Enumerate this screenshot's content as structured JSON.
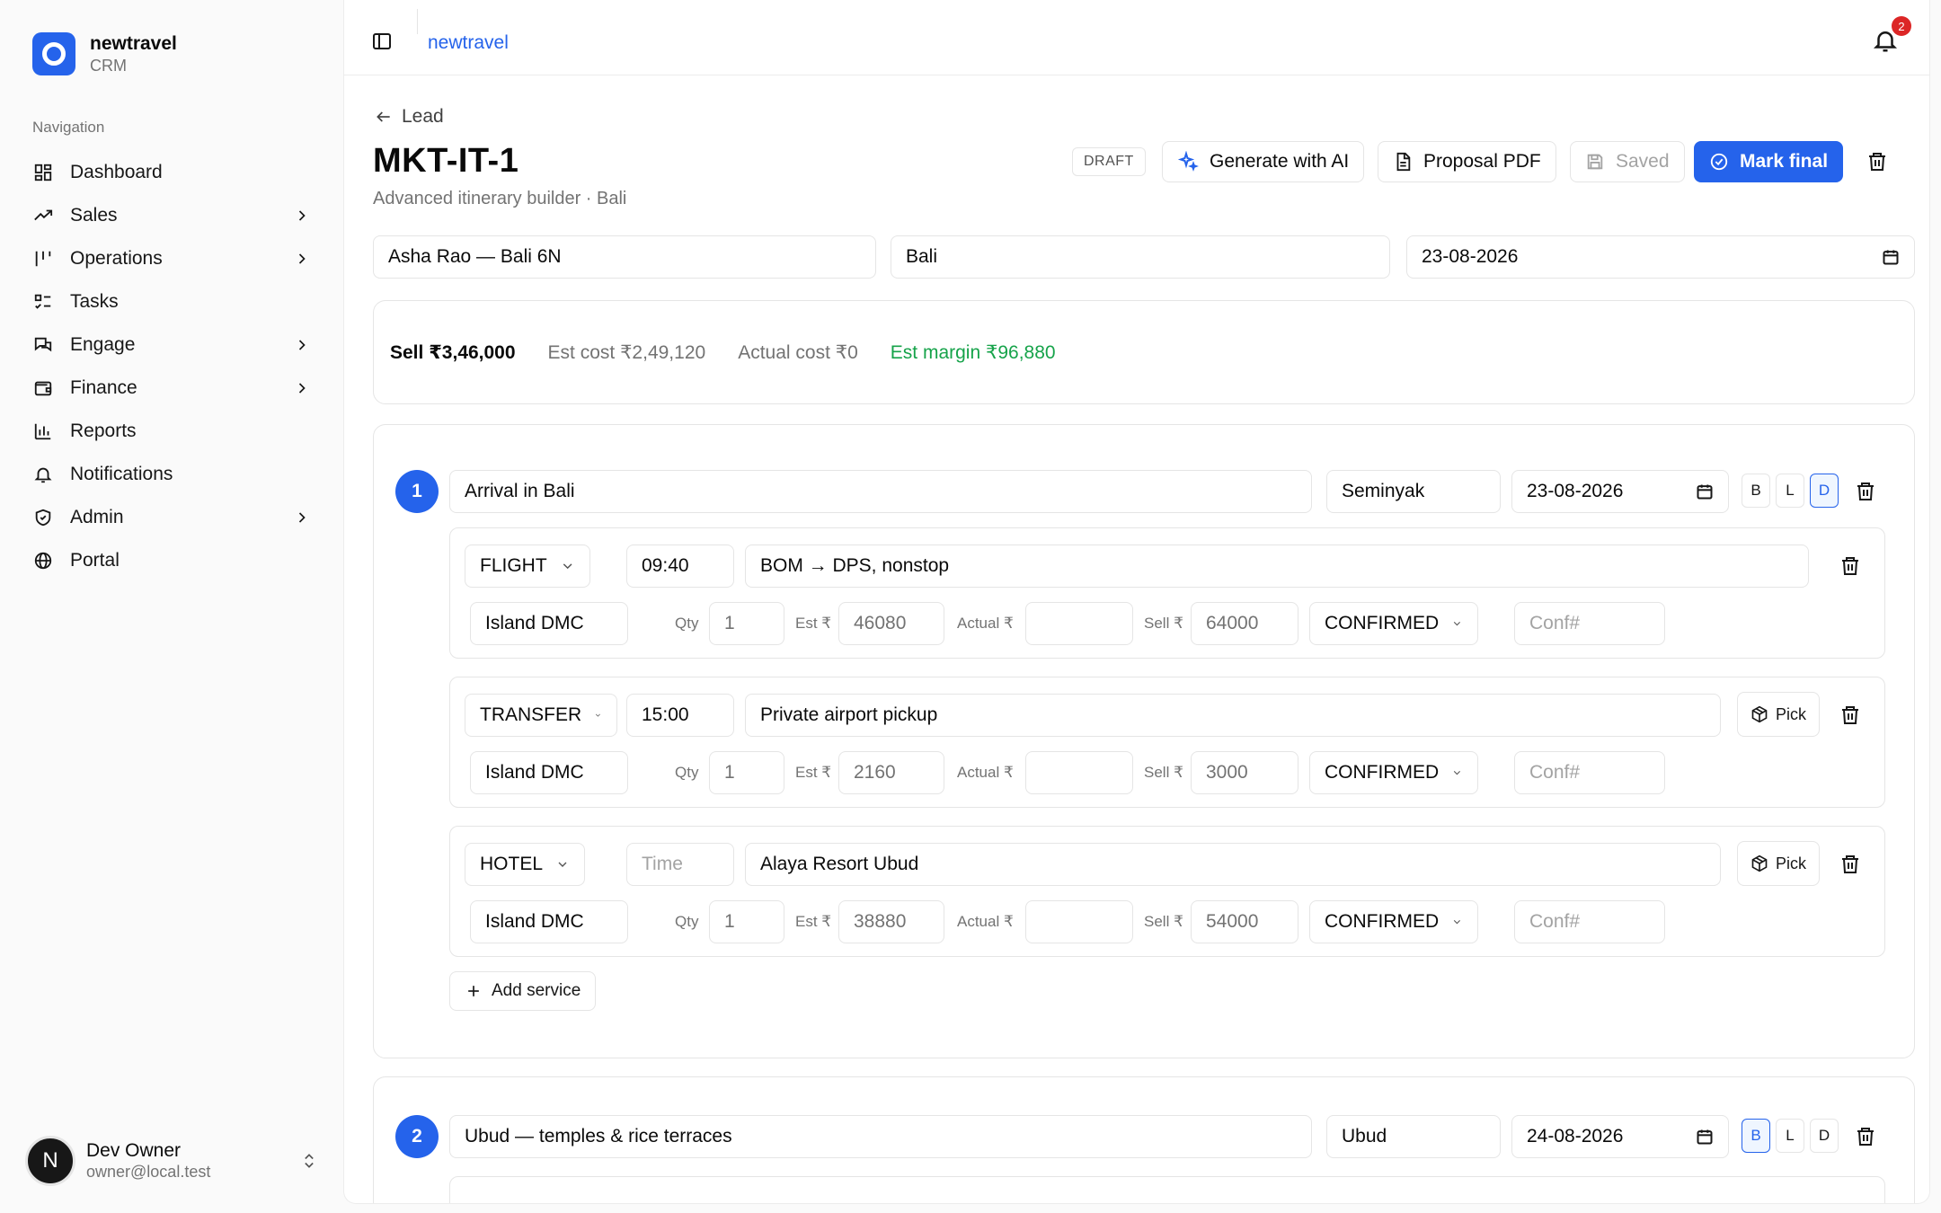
{
  "brand": {
    "name": "newtravel",
    "sub": "CRM"
  },
  "nav": {
    "title": "Navigation",
    "items": [
      {
        "label": "Dashboard",
        "icon": "dashboard-icon",
        "chevron": false
      },
      {
        "label": "Sales",
        "icon": "trending-icon",
        "chevron": true
      },
      {
        "label": "Operations",
        "icon": "operations-icon",
        "chevron": true
      },
      {
        "label": "Tasks",
        "icon": "tasks-icon",
        "chevron": false
      },
      {
        "label": "Engage",
        "icon": "messages-icon",
        "chevron": true
      },
      {
        "label": "Finance",
        "icon": "wallet-icon",
        "chevron": true
      },
      {
        "label": "Reports",
        "icon": "bar-chart-icon",
        "chevron": false
      },
      {
        "label": "Notifications",
        "icon": "bell-icon",
        "chevron": false
      },
      {
        "label": "Admin",
        "icon": "shield-icon",
        "chevron": true
      },
      {
        "label": "Portal",
        "icon": "globe-icon",
        "chevron": false
      }
    ]
  },
  "user": {
    "initial": "N",
    "name": "Dev Owner",
    "email": "owner@local.test"
  },
  "topbar": {
    "breadcrumb": "newtravel",
    "notification_count": "2"
  },
  "page": {
    "back_label": "Lead",
    "title": "MKT-IT-1",
    "subtitle": "Advanced itinerary builder · Bali",
    "status": "DRAFT",
    "actions": {
      "generate": "Generate with AI",
      "pdf": "Proposal PDF",
      "saved": "Saved",
      "final": "Mark final"
    },
    "fields": {
      "name": "Asha Rao — Bali 6N",
      "destination": "Bali",
      "start_date": "23-08-2026"
    }
  },
  "summary": {
    "sell": "Sell ₹3,46,000",
    "est_cost": "Est cost ₹2,49,120",
    "actual_cost": "Actual cost ₹0",
    "est_margin": "Est margin ₹96,880"
  },
  "labels": {
    "qty": "Qty",
    "est": "Est ₹",
    "actual": "Actual ₹",
    "sell": "Sell ₹",
    "pick": "Pick",
    "add_service": "Add service",
    "time_placeholder": "Time",
    "conf_placeholder": "Conf#"
  },
  "days": [
    {
      "number": "1",
      "title": "Arrival in Bali",
      "location": "Seminyak",
      "date": "23-08-2026",
      "meals": [
        "B",
        "L",
        "D"
      ],
      "meals_active": [
        false,
        false,
        true
      ],
      "services": [
        {
          "type": "FLIGHT",
          "time": "09:40",
          "description": "BOM → DPS, nonstop",
          "supplier": "Island DMC",
          "qty": "1",
          "est": "46080",
          "actual": "",
          "sell": "64000",
          "status": "CONFIRMED",
          "pick": false
        },
        {
          "type": "TRANSFER",
          "time": "15:00",
          "description": "Private airport pickup",
          "supplier": "Island DMC",
          "qty": "1",
          "est": "2160",
          "actual": "",
          "sell": "3000",
          "status": "CONFIRMED",
          "pick": true
        },
        {
          "type": "HOTEL",
          "time": "",
          "description": "Alaya Resort Ubud",
          "supplier": "Island DMC",
          "qty": "1",
          "est": "38880",
          "actual": "",
          "sell": "54000",
          "status": "CONFIRMED",
          "pick": true
        }
      ]
    },
    {
      "number": "2",
      "title": "Ubud — temples & rice terraces",
      "location": "Ubud",
      "date": "24-08-2026",
      "meals": [
        "B",
        "L",
        "D"
      ],
      "meals_active": [
        true,
        false,
        false
      ],
      "services": []
    }
  ],
  "colors": {
    "accent": "#2563eb",
    "margin": "#16a34a",
    "badge": "#dc2626"
  }
}
